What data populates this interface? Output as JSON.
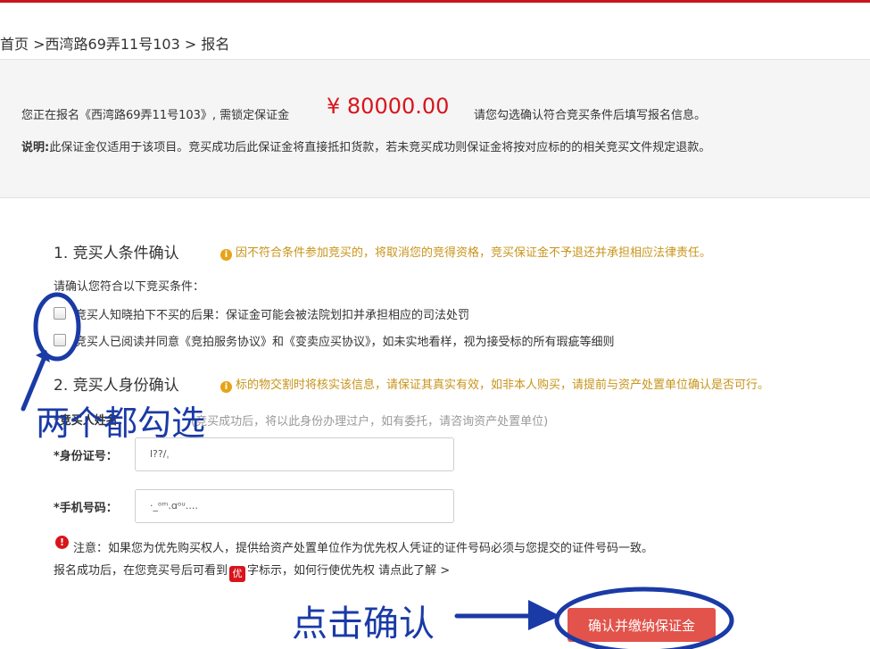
{
  "breadcrumb": {
    "home": "首页",
    "sep1": " >",
    "item": "西湾路69弄11号103",
    "sep2": " > ",
    "current": "报名"
  },
  "notice": {
    "prefix": "您正在报名《西湾路69弄11号103》, 需锁定保证金",
    "amount": "¥ 80000.00",
    "hint": "请您勾选确认符合竞买条件后填写报名信息。",
    "explain_label": "说明:",
    "explain_text": "此保证金仅适用于该项目。竞买成功后此保证金将直接抵扣货款，若未竞买成功则保证金将按对应标的的相关竞买文件规定退款。"
  },
  "section1": {
    "title": "1. 竞买人条件确认",
    "warning": "因不符合条件参加竞买的，将取消您的竞得资格，竞买保证金不予退还并承担相应法律责任。",
    "intro": "请确认您符合以下竞买条件：",
    "conditions": [
      "竞买人知晓拍下不买的后果：保证金可能会被法院划扣并承担相应的司法处罚",
      "竞买人已阅读并同意《竞拍服务协议》和《变卖应买协议》，如未实地看样，视为接受标的所有瑕疵等细则"
    ]
  },
  "section2": {
    "title": "2. 竞买人身份确认",
    "warning": "标的物交割时将核实该信息，请保证其真实有效，如非本人购买，请提前与资产处置单位确认是否可行。",
    "name_label": "*竞买人姓名：",
    "name_hint": "(竞买成功后，将以此身份办理过户，如有委托，请咨询资产处置单位)",
    "id_label": "*身份证号：",
    "id_value": "l??/ˌ",
    "phone_label": "*手机号码：",
    "phone_value": "·_ᵒᵐ.ɑᵒᵘ...."
  },
  "note": {
    "text": "注意：如果您为优先购买权人，提供给资产处置单位作为优先权人凭证的证件号码必须与您提交的证件号码一致。",
    "line2_before": "报名成功后，在您竞买号后可看到",
    "badge": "优",
    "line2_after": "字标示，如何行使优先权",
    "learn_more": "请点此了解 >"
  },
  "submit": {
    "label": "确认并缴纳保证金"
  },
  "annotations": {
    "check_both": "两个都勾选",
    "click_confirm": "点击确认"
  },
  "colors": {
    "accent": "#d9141b",
    "warning": "#c8941b",
    "annotation": "#1a3aa6",
    "button": "#e2534b"
  }
}
